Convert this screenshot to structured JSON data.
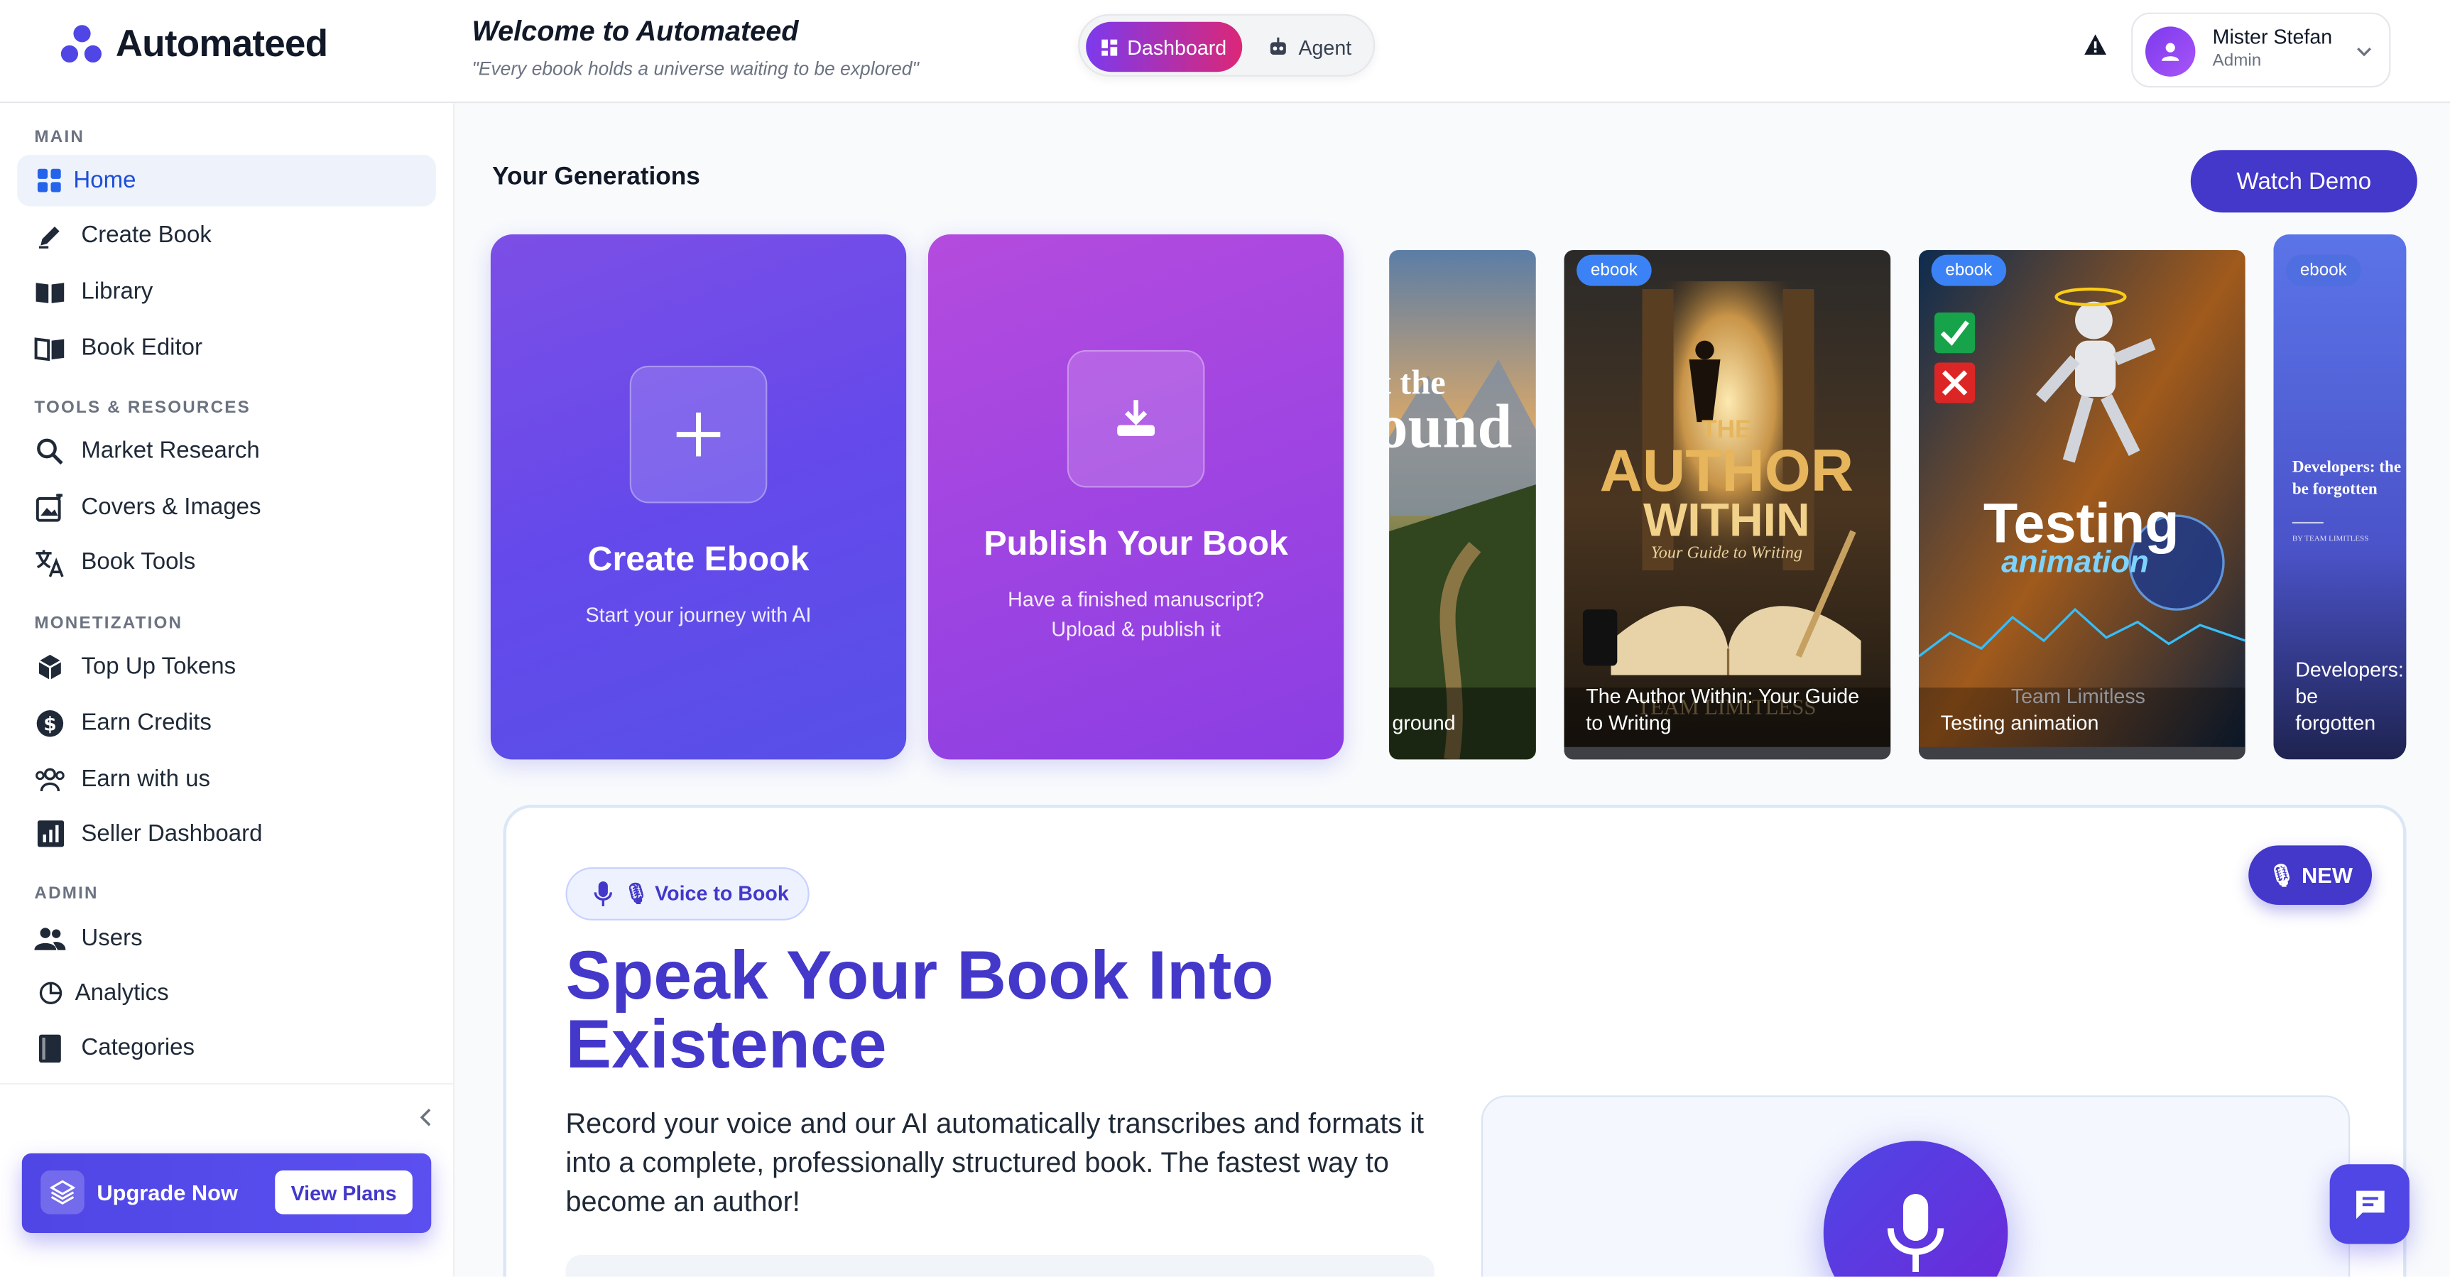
{
  "app": {
    "brand": "Automateed"
  },
  "header": {
    "welcome_title": "Welcome to Automateed",
    "welcome_quote": "\"Every ebook holds a universe waiting to be explored\"",
    "modes": [
      {
        "label": "Dashboard",
        "icon": "dashboard-icon",
        "active": true
      },
      {
        "label": "Agent",
        "icon": "robot-icon",
        "active": false
      }
    ],
    "user": {
      "name": "Mister Stefan",
      "role": "Admin"
    }
  },
  "sidebar": {
    "sections": [
      {
        "title": "MAIN",
        "items": [
          {
            "label": "Home",
            "icon": "grid-icon",
            "active": true
          },
          {
            "label": "Create Book",
            "icon": "pen-icon"
          },
          {
            "label": "Library",
            "icon": "book-open-icon"
          },
          {
            "label": "Book Editor",
            "icon": "book-edit-icon"
          }
        ]
      },
      {
        "title": "TOOLS & RESOURCES",
        "items": [
          {
            "label": "Market Research",
            "icon": "search-icon"
          },
          {
            "label": "Covers & Images",
            "icon": "image-icon"
          },
          {
            "label": "Book Tools",
            "icon": "translate-icon"
          }
        ]
      },
      {
        "title": "MONETIZATION",
        "items": [
          {
            "label": "Top Up Tokens",
            "icon": "cube-icon"
          },
          {
            "label": "Earn Credits",
            "icon": "dollar-icon"
          },
          {
            "label": "Earn with us",
            "icon": "group-icon"
          },
          {
            "label": "Seller Dashboard",
            "icon": "bar-chart-icon"
          }
        ]
      },
      {
        "title": "ADMIN",
        "items": [
          {
            "label": "Users",
            "icon": "users-icon"
          },
          {
            "label": "Analytics",
            "icon": "pie-icon"
          },
          {
            "label": "Categories",
            "icon": "book-icon"
          }
        ]
      }
    ],
    "upgrade": {
      "label": "Upgrade Now",
      "plans_label": "View Plans"
    }
  },
  "main": {
    "title": "Your Generations",
    "demo_label": "Watch Demo",
    "create_card": {
      "title": "Create Ebook",
      "subtitle": "Start your journey with AI"
    },
    "publish_card": {
      "title": "Publish Your Book",
      "subtitle_line1": "Have a finished manuscript?",
      "subtitle_line2": "Upload & publish it"
    },
    "books": [
      {
        "caption": "ground",
        "badge": ""
      },
      {
        "caption": "The Author Within: Your Guide to Writing",
        "badge": "ebook",
        "cover_line1": "THE",
        "cover_line2": "AUTHOR",
        "cover_line3": "WITHIN",
        "cover_sub": "Your Guide to Writing",
        "cover_author": "TEAM LIMITLESS"
      },
      {
        "caption": "Testing animation",
        "badge": "ebook",
        "cover_line1": "Testing",
        "cover_line2": "animation",
        "cover_author": "Team Limitless"
      },
      {
        "caption": "Developers: be forgotten",
        "badge": "ebook",
        "cover_line1": "Developers: the",
        "cover_line2": "be forgotten",
        "cover_author": "BY TEAM LIMITLESS"
      }
    ],
    "voice": {
      "chip": "🎙 Voice to Book",
      "new_label": "🎙 NEW",
      "heading": "Speak Your Book Into Existence",
      "description": "Record your voice and our AI automatically transcribes and formats it into a complete, professionally structured book. The fastest way to become an author!"
    }
  },
  "colors": {
    "accent": "#4f46e5",
    "accent_dark": "#4338ca",
    "active_nav_bg": "#eef3fb",
    "active_nav_text": "#1d4ed8"
  }
}
